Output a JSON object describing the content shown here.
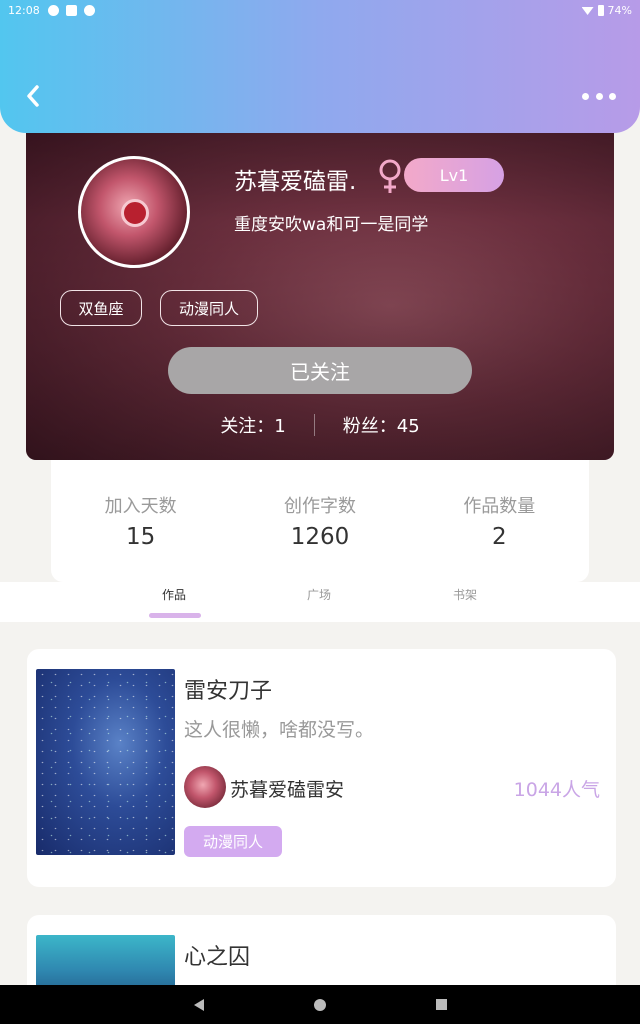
{
  "status_bar": {
    "time": "12:08",
    "battery": "74%"
  },
  "profile": {
    "username": "苏暮爱磕雷.",
    "gender_symbol": "♀",
    "level": "Lv1",
    "signature": "重度安吹wa和可一是同学",
    "tags": [
      "双鱼座",
      "动漫同人"
    ],
    "follow_button": "已关注",
    "following": "关注：1",
    "followers": "粉丝：45"
  },
  "stats": [
    {
      "label": "加入天数",
      "value": "15"
    },
    {
      "label": "创作字数",
      "value": "1260"
    },
    {
      "label": "作品数量",
      "value": "2"
    }
  ],
  "tabs": [
    {
      "label": "作品",
      "active": true
    },
    {
      "label": "广场",
      "active": false
    },
    {
      "label": "书架",
      "active": false
    }
  ],
  "works": [
    {
      "title": "雷安刀子",
      "description": "这人很懒，啥都没写。",
      "author": "苏暮爱磕雷安",
      "popularity": "1044人气",
      "tag": "动漫同人"
    },
    {
      "title": "心之囚"
    }
  ],
  "colors": {
    "header_start": "#52c6ef",
    "header_end": "#b79be8",
    "accent": "#c9a5e6"
  },
  "icons": [
    "back-icon",
    "more-icon",
    "female-icon"
  ]
}
